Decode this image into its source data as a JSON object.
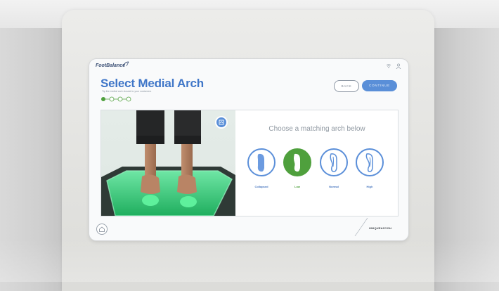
{
  "app": {
    "logo_text": "FootBalance",
    "title": "Select Medial Arch",
    "subtitle": "Tip the medial arch closest to your customers"
  },
  "header": {
    "back_label": "BACK",
    "continue_label": "CONTINUE",
    "progress": {
      "total_steps": 4,
      "current_step": 1
    }
  },
  "status_icons": [
    "wifi-icon",
    "user-icon"
  ],
  "main": {
    "prompt": "Choose a matching arch below",
    "camera_button_icon": "camera-icon",
    "arch_options": [
      {
        "label": "Collapsed",
        "selected": false
      },
      {
        "label": "Low",
        "selected": true
      },
      {
        "label": "Normal",
        "selected": false
      },
      {
        "label": "High",
        "selected": false
      }
    ]
  },
  "footer": {
    "home_icon": "home-icon",
    "tagline": "UNIQUEASYOU."
  },
  "colors": {
    "accent": "#5a8fd8",
    "title": "#3f76c8",
    "selected": "#4fa03d",
    "glow": "#3fd37f"
  }
}
